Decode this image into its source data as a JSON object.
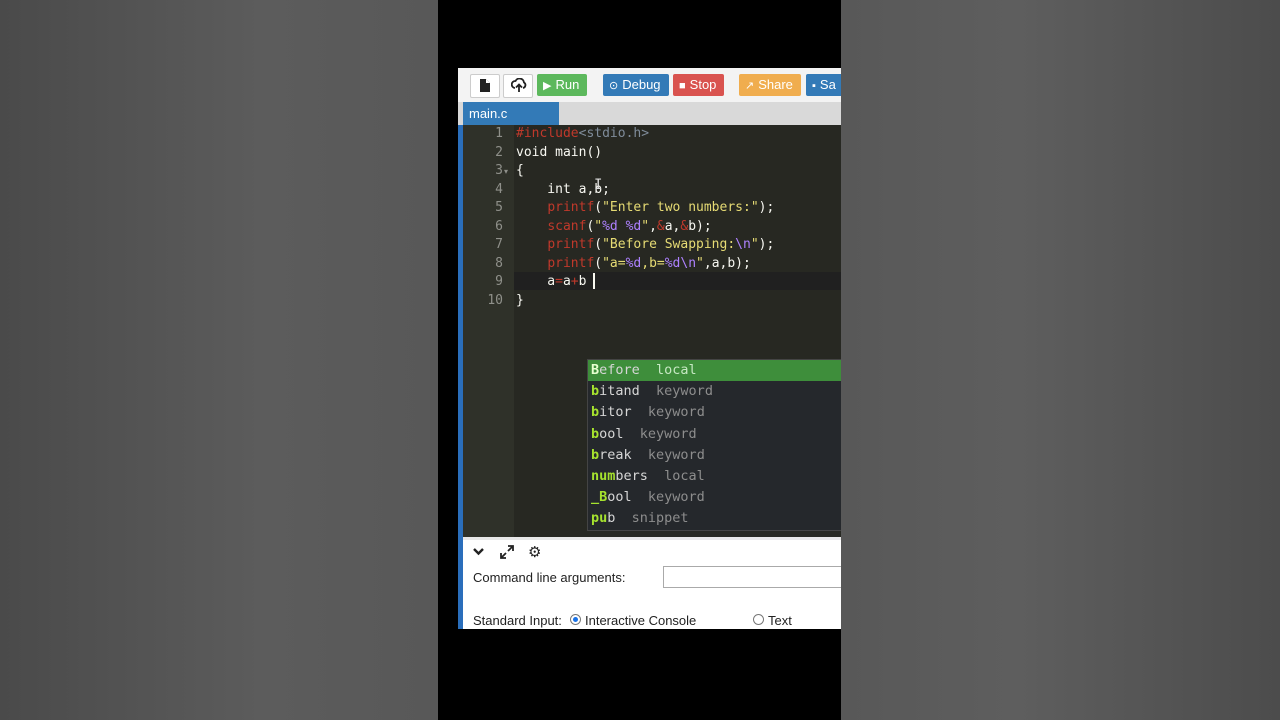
{
  "toolbar": {
    "run_label": "Run",
    "debug_label": "Debug",
    "stop_label": "Stop",
    "share_label": "Share",
    "save_label": "Sa",
    "run_color": "#5cb85c",
    "debug_color": "#337ab7",
    "stop_color": "#d9534f",
    "share_color": "#f0ad4e",
    "save_color": "#337ab7"
  },
  "tabs": [
    {
      "label": "main.c",
      "active": true
    }
  ],
  "editor": {
    "line_numbers": [
      "1",
      "2",
      "3",
      "4",
      "5",
      "6",
      "7",
      "8",
      "9",
      "10"
    ],
    "lines": [
      "#include<stdio.h>",
      "void main()",
      "{",
      "    int a,b;",
      "    printf(\"Enter two numbers:\");",
      "    scanf(\"%d %d\",&a,&b);",
      "    printf(\"Before Swapping:\\n\");",
      "    printf(\"a=%d,b=%d\\n\",a,b);",
      "    a=a+b",
      "}"
    ],
    "cursor_line": 9
  },
  "autocomplete": [
    {
      "match": "B",
      "rest": "efore",
      "pad": "  ",
      "meta": "local",
      "selected": true
    },
    {
      "match": "b",
      "rest": "itand",
      "pad": "  ",
      "meta": "keyword",
      "selected": false
    },
    {
      "match": "b",
      "rest": "itor",
      "pad": "  ",
      "meta": "keyword",
      "selected": false
    },
    {
      "match": "b",
      "rest": "ool",
      "pad": "  ",
      "meta": "keyword",
      "selected": false
    },
    {
      "match": "b",
      "rest": "reak",
      "pad": "  ",
      "meta": "keyword",
      "selected": false
    },
    {
      "match": "num",
      "rest": "bers",
      "pad": "  ",
      "meta": "local",
      "selected": false
    },
    {
      "match": "_B",
      "rest": "ool",
      "pad": "  ",
      "meta": "keyword",
      "selected": false
    },
    {
      "match": "pu",
      "rest": "b",
      "pad": "  ",
      "meta": "snippet",
      "selected": false
    }
  ],
  "bottom": {
    "cmd_args_label": "Command line arguments:",
    "cmd_args_value": "",
    "stdin_label": "Standard Input:",
    "option_interactive": "Interactive Console",
    "option_text": "Text",
    "selected_option": "Interactive Console"
  },
  "icons": [
    "new-file-icon",
    "upload-icon",
    "play-icon",
    "debug-icon",
    "stop-icon",
    "share-icon",
    "save-icon",
    "collapse-icon",
    "expand-icon",
    "gear-icon"
  ]
}
